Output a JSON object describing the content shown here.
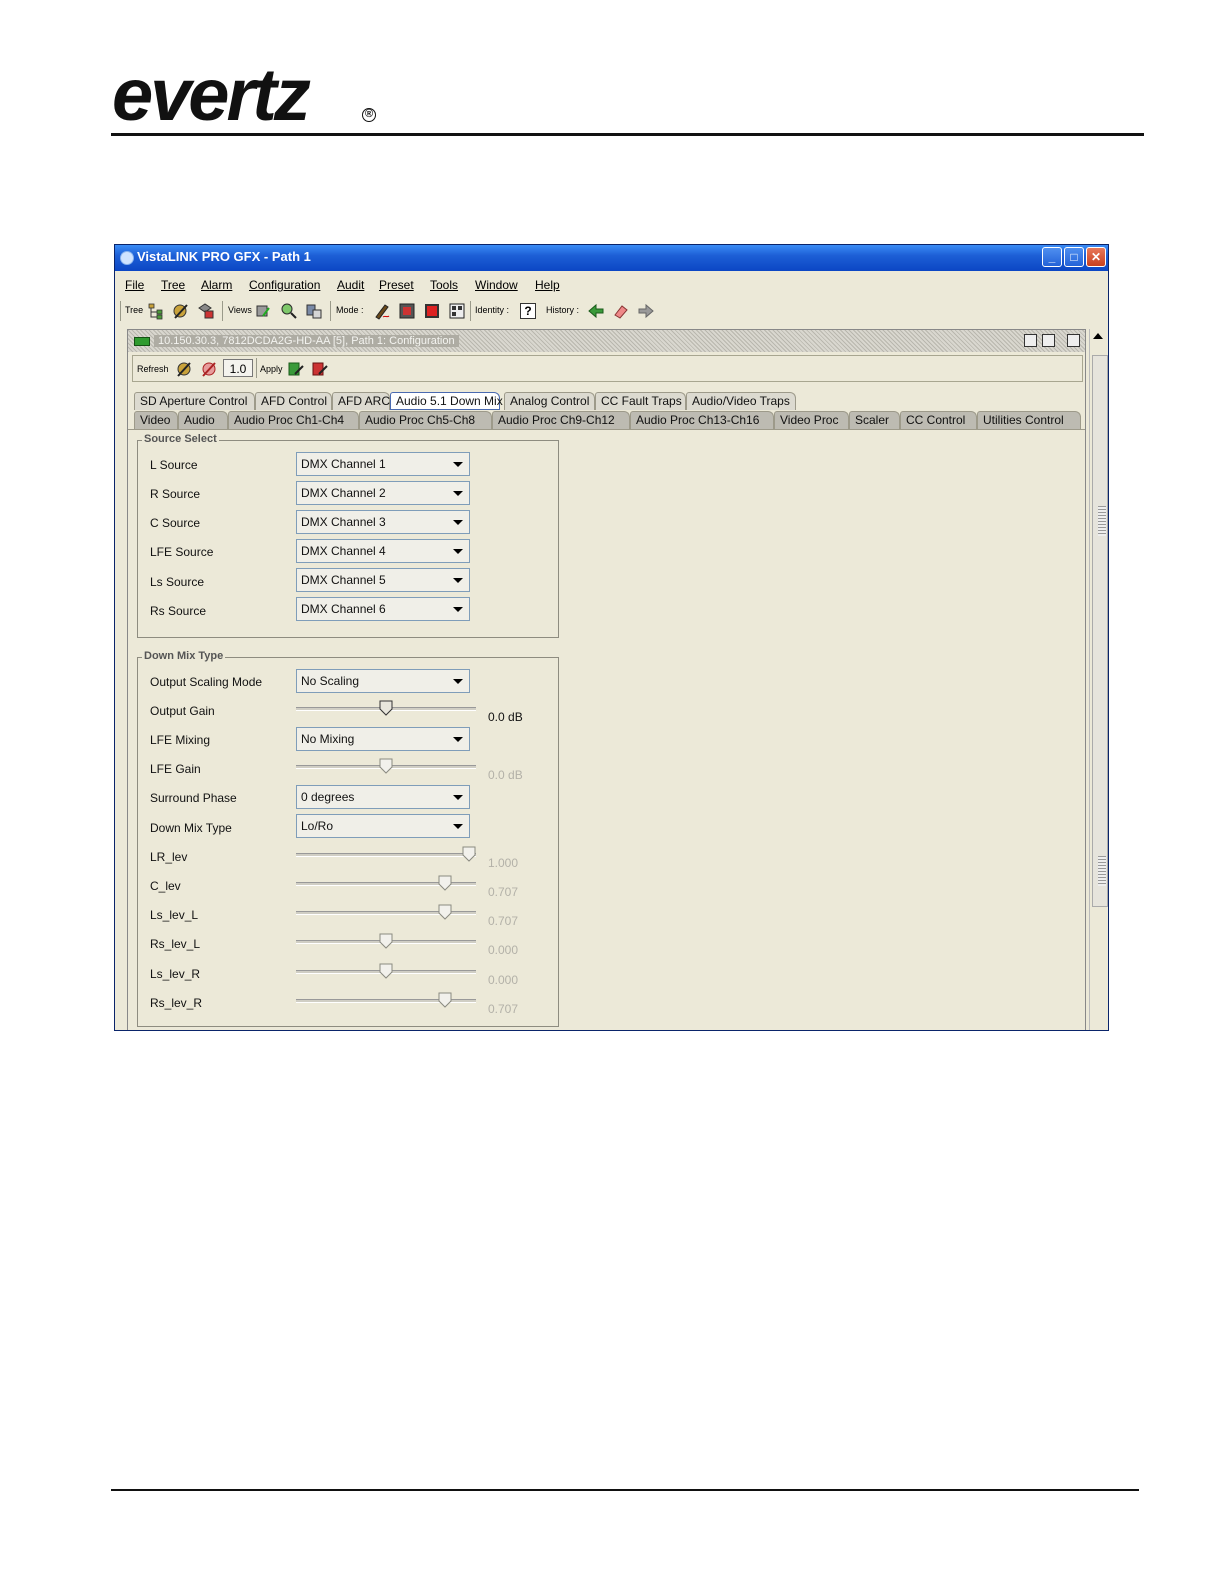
{
  "logo": {
    "text": "evertz",
    "registered": "®"
  },
  "window": {
    "title": "VistaLINK PRO GFX - Path 1",
    "menu": [
      "File",
      "Tree",
      "Alarm",
      "Configuration",
      "Audit",
      "Preset",
      "Tools",
      "Window",
      "Help"
    ],
    "toolbar": {
      "tree_label": "Tree",
      "views_label": "Views",
      "mode_label": "Mode :",
      "identity_label": "Identity :",
      "history_label": "History :",
      "identity_icon": "?"
    }
  },
  "inner": {
    "title": "10.150.30.3, 7812DCDA2G-HD-AA  [5], Path 1: Configuration",
    "toolbar": {
      "refresh_label": "Refresh",
      "version": "1.0",
      "apply_label": "Apply"
    },
    "tabs_row1": [
      "SD Aperture Control",
      "AFD Control",
      "AFD ARC",
      "Audio 5.1 Down Mix",
      "Analog Control",
      "CC Fault Traps",
      "Audio/Video Traps"
    ],
    "active_tab": "Audio 5.1 Down Mix",
    "tabs_row2": [
      "Video",
      "Audio",
      "Audio Proc Ch1-Ch4",
      "Audio Proc Ch5-Ch8",
      "Audio Proc Ch9-Ch12",
      "Audio Proc Ch13-Ch16",
      "Video Proc",
      "Scaler",
      "CC Control",
      "Utilities Control"
    ]
  },
  "source_select": {
    "title": "Source Select",
    "rows": [
      {
        "label": "L Source",
        "value": "DMX Channel 1"
      },
      {
        "label": "R Source",
        "value": "DMX Channel 2"
      },
      {
        "label": "C Source",
        "value": "DMX Channel 3"
      },
      {
        "label": "LFE Source",
        "value": "DMX Channel 4"
      },
      {
        "label": "Ls Source",
        "value": "DMX Channel 5"
      },
      {
        "label": "Rs Source",
        "value": "DMX Channel 6"
      }
    ]
  },
  "down_mix": {
    "title": "Down Mix Type",
    "output_scaling_mode": {
      "label": "Output Scaling Mode",
      "value": "No Scaling"
    },
    "output_gain": {
      "label": "Output Gain",
      "value": "0.0 dB",
      "level": 0.5
    },
    "lfe_mixing": {
      "label": "LFE Mixing",
      "value": "No Mixing"
    },
    "lfe_gain": {
      "label": "LFE Gain",
      "value": "0.0 dB",
      "level": 0.5
    },
    "surround_phase": {
      "label": "Surround Phase",
      "value": "0 degrees"
    },
    "down_mix_type": {
      "label": "Down Mix Type",
      "value": "Lo/Ro"
    },
    "levels": [
      {
        "label": "LR_lev",
        "value": "1.000",
        "level": 1.0
      },
      {
        "label": "C_lev",
        "value": "0.707",
        "level": 0.857
      },
      {
        "label": "Ls_lev_L",
        "value": "0.707",
        "level": 0.857
      },
      {
        "label": "Rs_lev_L",
        "value": "0.000",
        "level": 0.5
      },
      {
        "label": "Ls_lev_R",
        "value": "0.000",
        "level": 0.5
      },
      {
        "label": "Rs_lev_R",
        "value": "0.707",
        "level": 0.857
      }
    ]
  }
}
